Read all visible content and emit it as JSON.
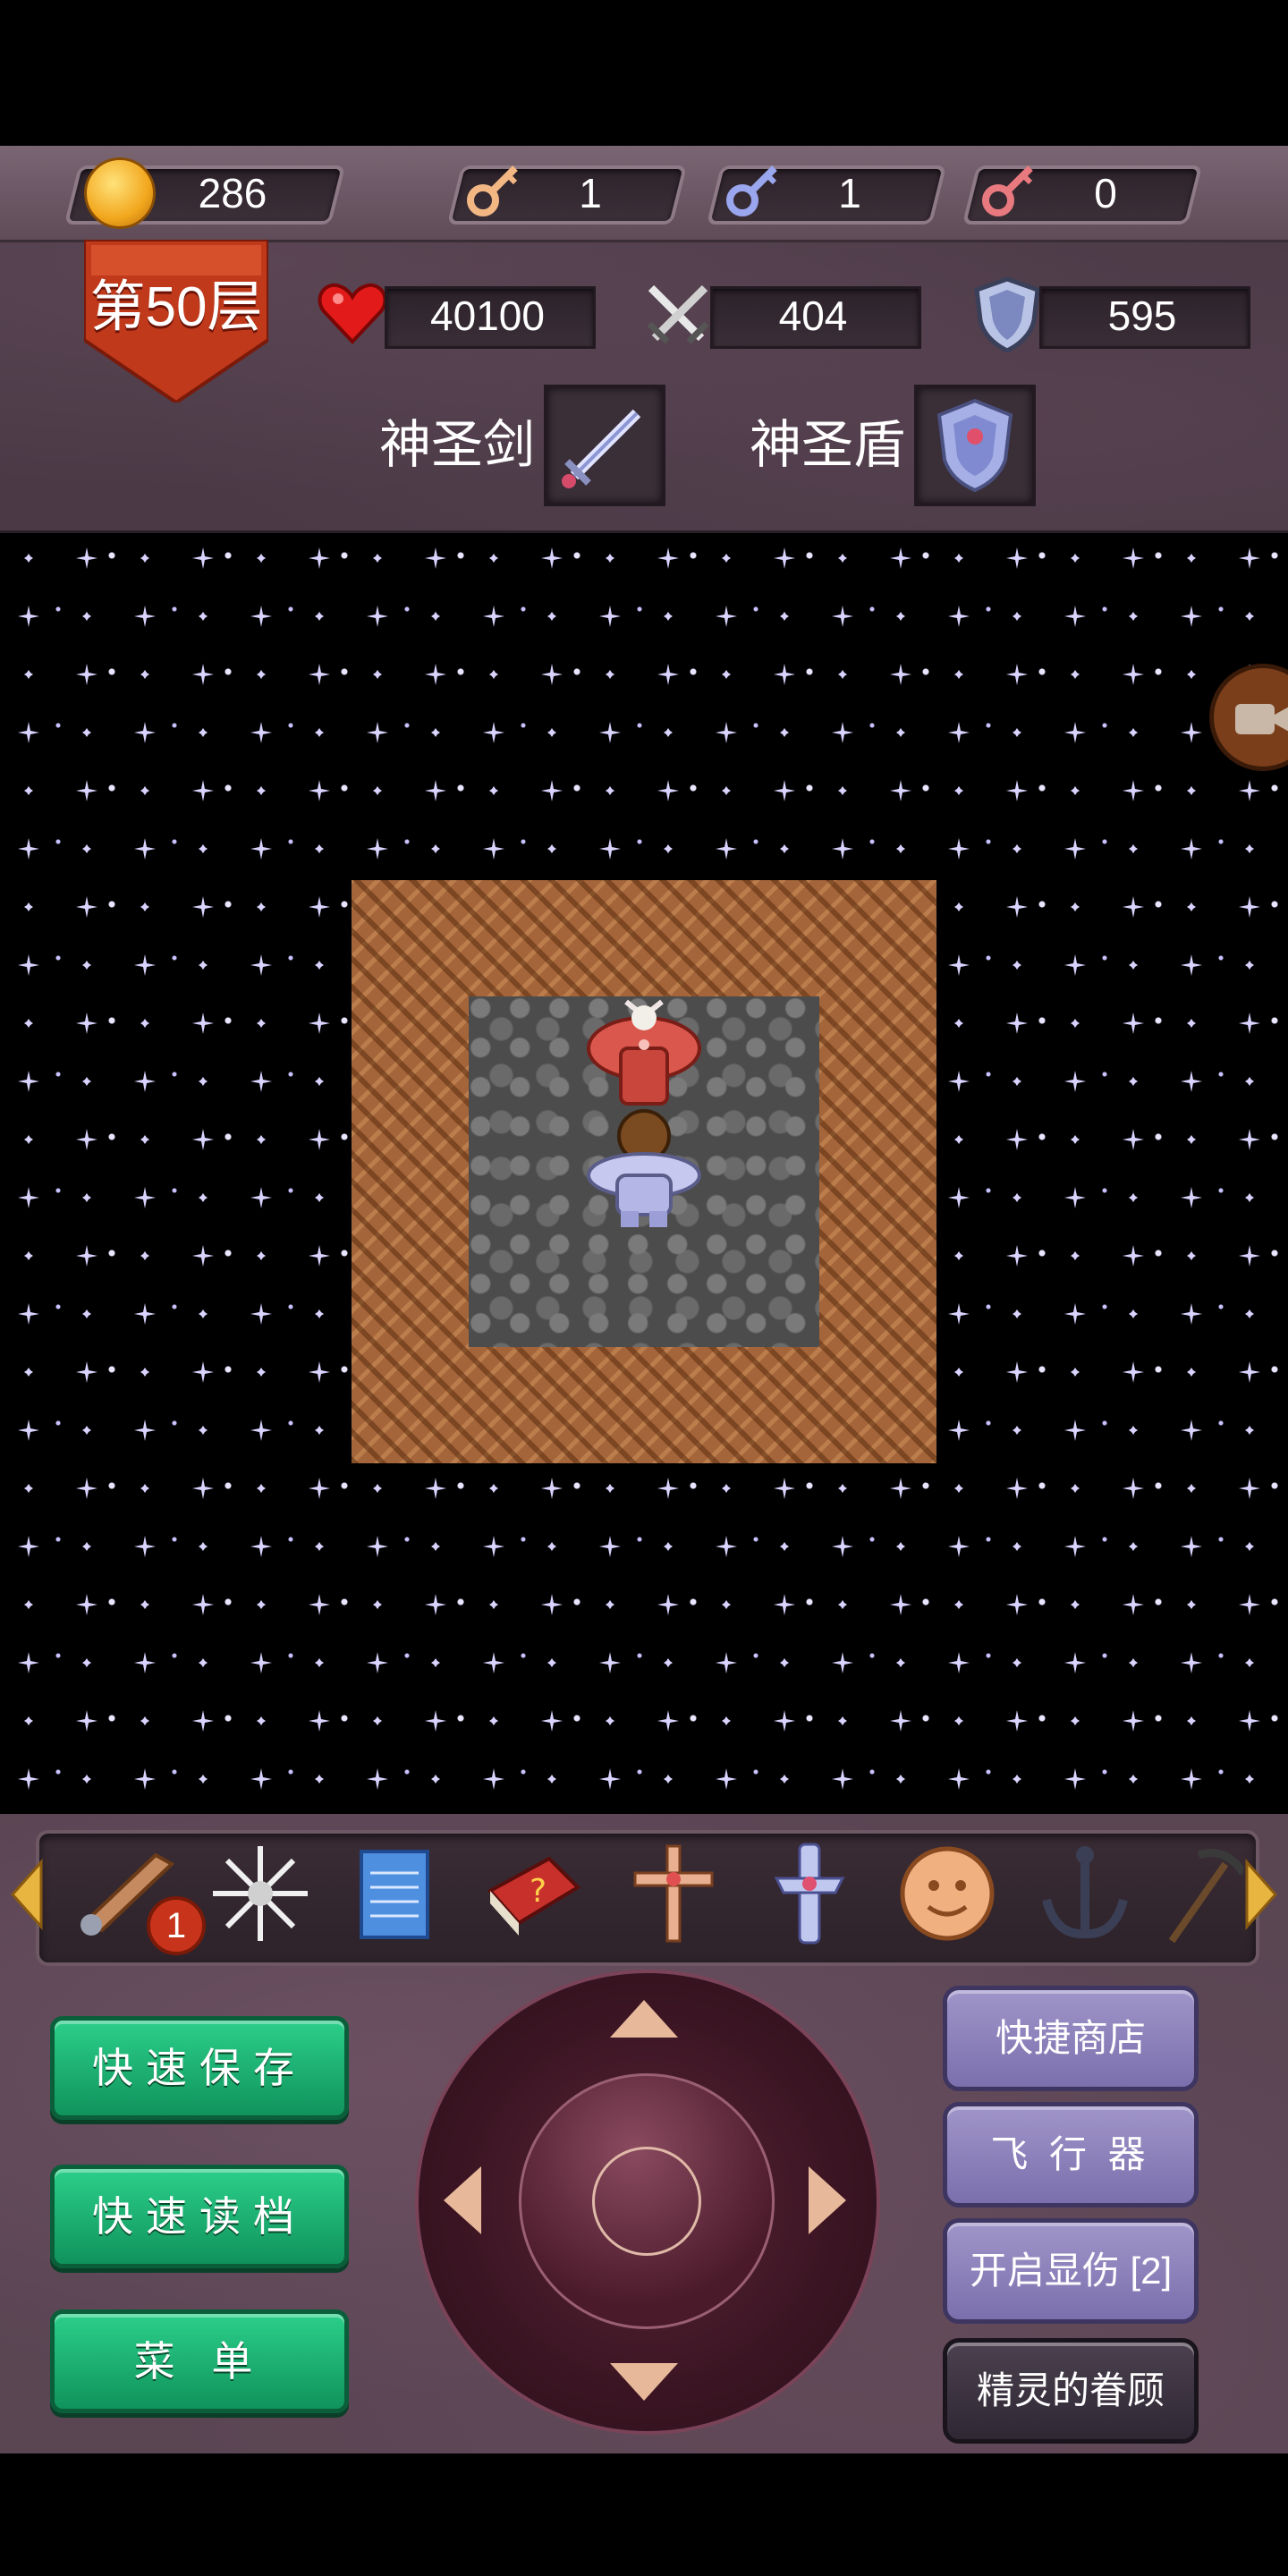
{
  "hud": {
    "gold": "286",
    "yellow_keys": "1",
    "blue_keys": "1",
    "red_keys": "0",
    "floor": "第50层",
    "hp": "40100",
    "attack": "404",
    "defense": "595",
    "weapon_label": "神圣剑",
    "shield_label": "神圣盾"
  },
  "inventory": {
    "items": [
      "wing-item-icon",
      "snowflake-item-icon",
      "notebook-item-icon",
      "monster-book-icon",
      "cross-item-icon",
      "holy-cross-item-icon",
      "coin-face-item-icon",
      "anchor-item-icon",
      "pickaxe-item-icon"
    ],
    "badge_count": "1"
  },
  "buttons": {
    "quick_save": "快速保存",
    "quick_load": "快速读档",
    "menu": "菜 单",
    "quick_shop": "快捷商店",
    "flyer": "飞 行 器",
    "show_damage": "开启显伤 [2]",
    "spirit_blessing": "精灵的眷顾"
  },
  "colors": {
    "hud_bg": "#4b3a46",
    "green_button": "#1bb877",
    "purple_button": "#8d82bb",
    "floor_banner": "#c0391b"
  }
}
